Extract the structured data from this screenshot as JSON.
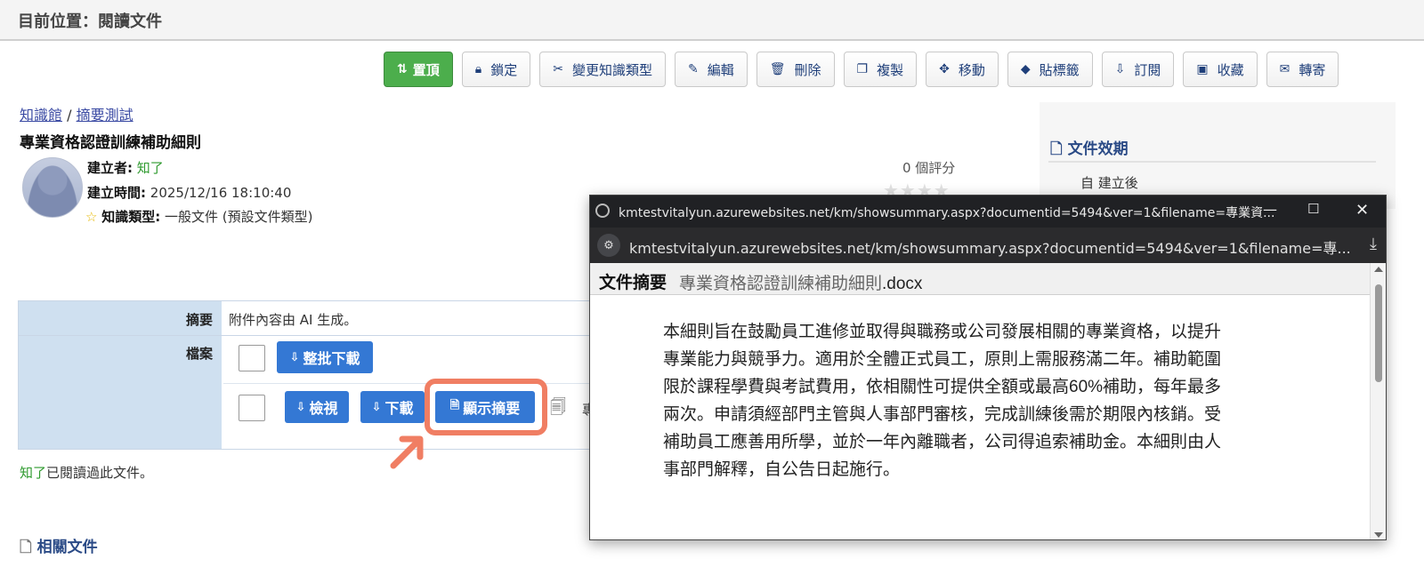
{
  "location": {
    "title": "目前位置：閱讀文件"
  },
  "toolbar": [
    {
      "label": "置頂",
      "icon": "pin-top-icon"
    },
    {
      "label": "鎖定",
      "icon": "lock-icon"
    },
    {
      "label": "變更知識類型",
      "icon": "scissors-icon"
    },
    {
      "label": "編輯",
      "icon": "edit-icon"
    },
    {
      "label": "刪除",
      "icon": "trash-icon"
    },
    {
      "label": "複製",
      "icon": "copy-icon"
    },
    {
      "label": "移動",
      "icon": "move-icon"
    },
    {
      "label": "貼標籤",
      "icon": "tag-icon"
    },
    {
      "label": "訂閱",
      "icon": "subscribe-icon"
    },
    {
      "label": "收藏",
      "icon": "bookmark-icon"
    },
    {
      "label": "轉寄",
      "icon": "mail-icon"
    }
  ],
  "breadcrumb": {
    "root": "知識館",
    "sep": "/",
    "folder": "摘要測試"
  },
  "document": {
    "title": "專業資格認證訓練補助細則",
    "creator_label": "建立者:",
    "creator": "知了",
    "created_label": "建立時間:",
    "created": "2025/12/16 18:10:40",
    "type_label": "知識類型:",
    "type": "一般文件 (預設文件類型)",
    "rating": "0 個評分"
  },
  "validity": {
    "heading": "文件效期",
    "row1": "自 建立後"
  },
  "attachments": {
    "summary_label": "摘要",
    "summary_value": "附件內容由 AI 生成。",
    "files_label": "檔案",
    "batch_download": "整批下載",
    "view": "檢視",
    "download": "下載",
    "show_summary": "顯示摘要",
    "file_name_start": "專"
  },
  "read_note": {
    "user": "知了",
    "text": "已閱讀過此文件。"
  },
  "related": {
    "heading": "相關文件"
  },
  "popup": {
    "window_title": "kmtestvitalyun.azurewebsites.net/km/showsummary.aspx?documentid=5494&ver=1&filename=專業資...",
    "url": "kmtestvitalyun.azurewebsites.net/km/showsummary.aspx?documentid=5494&ver=1&filename=專...",
    "heading": "文件摘要",
    "filename": "專業資格認證訓練補助細則",
    "ext": ".docx",
    "body_lines": [
      "本細則旨在鼓勵員工進修並取得與職務或公司發展相關的專業資格，以提升",
      "專業能力與競爭力。適用於全體正式員工，原則上需服務滿二年。補助範圍",
      "限於課程學費與考試費用，依相關性可提供全額或最高60%補助，每年最多",
      "兩次。申請須經部門主管與人事部門審核，完成訓練後需於期限內核銷。受",
      "補助員工應善用所學，並於一年內離職者，公司得追索補助金。本細則由人",
      "事部門解釋，自公告日起施行。"
    ]
  }
}
